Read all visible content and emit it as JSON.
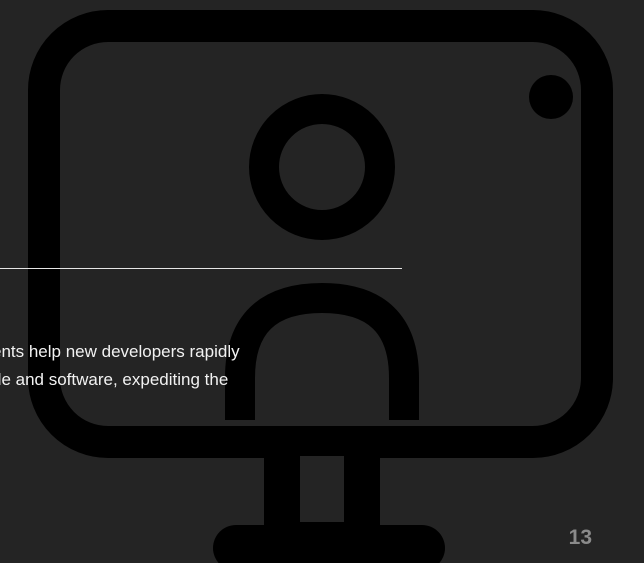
{
  "slide": {
    "background_color": "#242424",
    "icon_color": "#000000",
    "decorative_icon": "monitor-user-icon",
    "body_lines": [
      "ents help new developers rapidly",
      "de and software, expediting the"
    ],
    "page_number": "13"
  }
}
